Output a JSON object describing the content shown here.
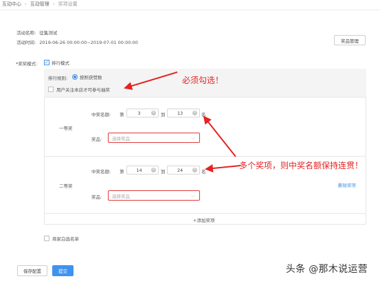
{
  "breadcrumb": {
    "items": [
      "互动中心",
      "互动管理",
      "奖项设置"
    ]
  },
  "activity": {
    "name_label": "活动名称:",
    "name_value": "征集测试",
    "time_label": "活动时间:",
    "time_value": "2019-06-26 00:00:00~2019-07-01 00:00:00"
  },
  "prize_manage_button": "奖品管理",
  "mode": {
    "label": "*奖奖模式:",
    "checkbox_label": "排行模式",
    "checked": true
  },
  "rule": {
    "label": "排行规则:",
    "radio_label": "按照获赞数"
  },
  "follow_checkbox_label": "用户关注本店才可参与抽奖",
  "prizes": [
    {
      "level": "一等奖",
      "rank_label": "中奖名额:",
      "first": "第",
      "from": "3",
      "to_label": "到",
      "to": "13",
      "suffix": "名",
      "prize_label": "奖品:",
      "select_placeholder": "选择奖品"
    },
    {
      "level": "二等奖",
      "rank_label": "中奖名额:",
      "first": "第",
      "from": "14",
      "to_label": "到",
      "to": "24",
      "suffix": "名",
      "prize_label": "奖品:",
      "select_placeholder": "选择奖品",
      "delete_label": "删除奖项"
    }
  ],
  "add_prize_label": "+添加奖项",
  "merchant_whitelist_label": "商家白选名单",
  "save_button": "保存配置",
  "submit_button": "提交",
  "annotations": {
    "must_check": "必须勾选！",
    "continuous": "多个奖项，则中奖名额保持连贯！"
  },
  "watermark": "头条 @那木说运营",
  "colors": {
    "accent": "#3f93ee",
    "annotation": "#e52222",
    "invalid_border": "#e03a3a"
  }
}
